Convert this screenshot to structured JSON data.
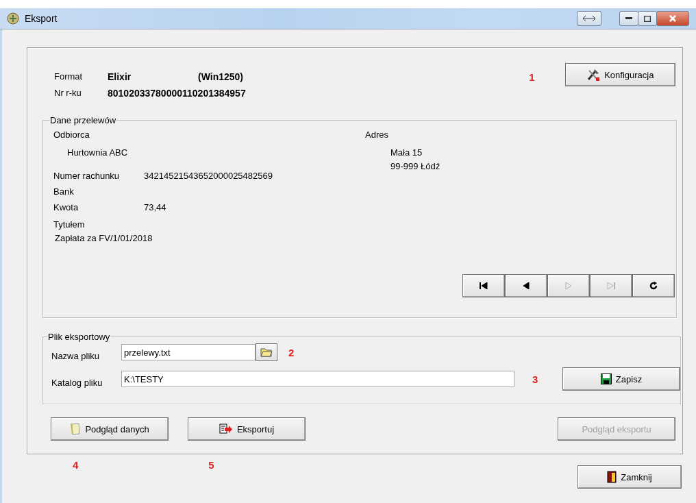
{
  "window": {
    "title": "Eksport"
  },
  "header": {
    "format_label": "Format",
    "format_value": "Elixir",
    "encoding": "(Win1250)",
    "account_label": "Nr r-ku",
    "account_value": "80102033780000110201384957"
  },
  "config_button": {
    "label": "Konfiguracja",
    "annotation": "1"
  },
  "transfer_group": {
    "title": "Dane przelewów",
    "recipient_label": "Odbiorca",
    "recipient": "Hurtownia ABC",
    "address_label": "Adres",
    "address_lines": [
      "Mała 15",
      "99-999 Łódź"
    ],
    "fields": [
      {
        "label": "Numer rachunku",
        "value": "34214521543652000025482569"
      },
      {
        "label": "Bank"
      },
      {
        "label": "Kwota",
        "value": "73,44"
      }
    ],
    "title_label": "Tytułem",
    "title_value": "Zapłata za FV/1/01/2018",
    "nav_buttons": [
      {
        "kind": "first",
        "disabled": false
      },
      {
        "kind": "prev",
        "disabled": false
      },
      {
        "kind": "next",
        "disabled": true
      },
      {
        "kind": "last",
        "disabled": true
      },
      {
        "kind": "refresh",
        "disabled": false
      }
    ]
  },
  "file_group": {
    "title": "Plik eksportowy",
    "name_label": "Nazwa pliku",
    "name_value": "przelewy.txt",
    "name_annotation": "2",
    "dir_label": "Katalog pliku",
    "dir_value": "K:\\TESTY",
    "dir_annotation": "3",
    "save_button": "Zapisz"
  },
  "actions": [
    {
      "kind": "preview_data",
      "label": "Podgląd danych",
      "annotation": "4",
      "disabled": false
    },
    {
      "kind": "export",
      "label": "Eksportuj",
      "annotation": "5",
      "disabled": false
    },
    {
      "kind": "preview_export",
      "label": "Podgląd eksportu",
      "disabled": true
    }
  ],
  "close_button": "Zamknij"
}
